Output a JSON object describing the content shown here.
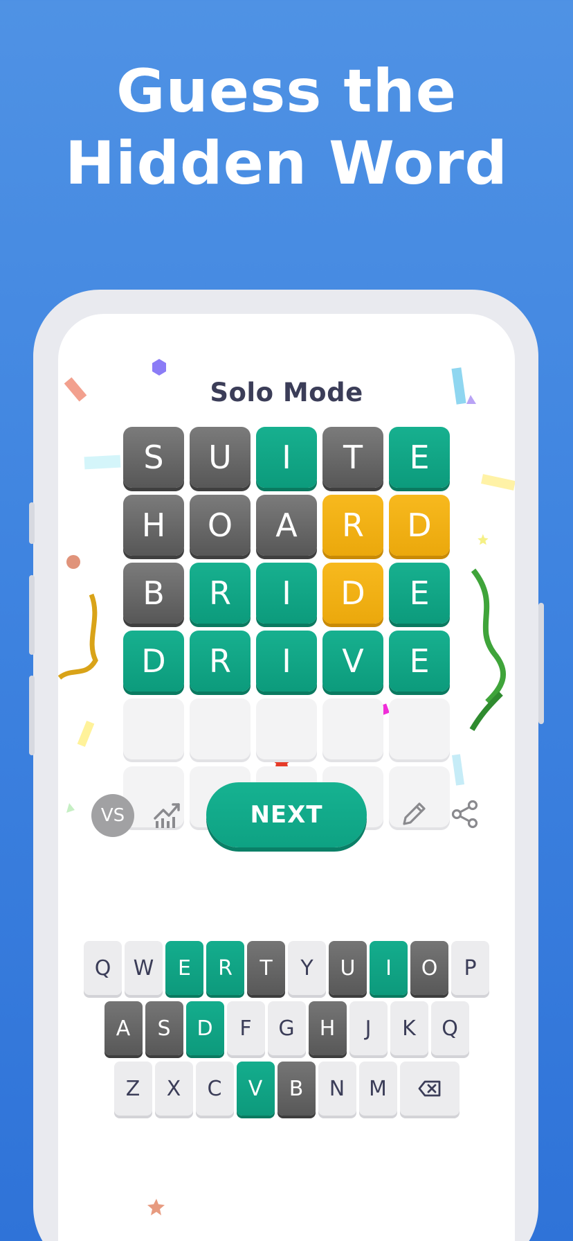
{
  "headline": {
    "line1": "Guess the",
    "line2": "Hidden Word"
  },
  "mode_title": "Solo Mode",
  "board": [
    [
      {
        "l": "S",
        "s": "gray"
      },
      {
        "l": "U",
        "s": "gray"
      },
      {
        "l": "I",
        "s": "green"
      },
      {
        "l": "T",
        "s": "gray"
      },
      {
        "l": "E",
        "s": "green"
      }
    ],
    [
      {
        "l": "H",
        "s": "gray"
      },
      {
        "l": "O",
        "s": "gray"
      },
      {
        "l": "A",
        "s": "gray"
      },
      {
        "l": "R",
        "s": "yellow"
      },
      {
        "l": "D",
        "s": "yellow"
      }
    ],
    [
      {
        "l": "B",
        "s": "gray"
      },
      {
        "l": "R",
        "s": "green"
      },
      {
        "l": "I",
        "s": "green"
      },
      {
        "l": "D",
        "s": "yellow"
      },
      {
        "l": "E",
        "s": "green"
      }
    ],
    [
      {
        "l": "D",
        "s": "green"
      },
      {
        "l": "R",
        "s": "green"
      },
      {
        "l": "I",
        "s": "green"
      },
      {
        "l": "V",
        "s": "green"
      },
      {
        "l": "E",
        "s": "green"
      }
    ],
    [
      {
        "l": "",
        "s": "empty"
      },
      {
        "l": "",
        "s": "empty"
      },
      {
        "l": "",
        "s": "empty"
      },
      {
        "l": "",
        "s": "empty"
      },
      {
        "l": "",
        "s": "empty"
      }
    ],
    [
      {
        "l": "",
        "s": "empty"
      },
      {
        "l": "",
        "s": "empty"
      },
      {
        "l": "",
        "s": "empty"
      },
      {
        "l": "",
        "s": "empty"
      },
      {
        "l": "",
        "s": "empty"
      }
    ]
  ],
  "controls": {
    "vs_label": "VS",
    "next_label": "NEXT",
    "stats_icon": "stats-chart-icon",
    "edit_icon": "pencil-icon",
    "share_icon": "share-icon"
  },
  "keyboard": [
    [
      {
        "k": "Q",
        "s": "default"
      },
      {
        "k": "W",
        "s": "default"
      },
      {
        "k": "E",
        "s": "green"
      },
      {
        "k": "R",
        "s": "green"
      },
      {
        "k": "T",
        "s": "gray"
      },
      {
        "k": "Y",
        "s": "default"
      },
      {
        "k": "U",
        "s": "gray"
      },
      {
        "k": "I",
        "s": "green"
      },
      {
        "k": "O",
        "s": "gray"
      },
      {
        "k": "P",
        "s": "default"
      }
    ],
    [
      {
        "k": "A",
        "s": "gray"
      },
      {
        "k": "S",
        "s": "gray"
      },
      {
        "k": "D",
        "s": "green"
      },
      {
        "k": "F",
        "s": "default"
      },
      {
        "k": "G",
        "s": "default"
      },
      {
        "k": "H",
        "s": "gray"
      },
      {
        "k": "J",
        "s": "default"
      },
      {
        "k": "K",
        "s": "default"
      },
      {
        "k": "Q",
        "s": "default"
      }
    ],
    [
      {
        "k": "Z",
        "s": "default"
      },
      {
        "k": "X",
        "s": "default"
      },
      {
        "k": "C",
        "s": "default"
      },
      {
        "k": "V",
        "s": "green"
      },
      {
        "k": "B",
        "s": "gray"
      },
      {
        "k": "N",
        "s": "default"
      },
      {
        "k": "M",
        "s": "default"
      },
      {
        "k": "",
        "s": "default",
        "icon": "backspace-icon"
      }
    ]
  ],
  "colors": {
    "background": "#3f84e0",
    "green": "#0fa383",
    "yellow": "#f2b215",
    "gray": "#6a6a6a",
    "key": "#ececee",
    "text": "#3b3d58"
  }
}
